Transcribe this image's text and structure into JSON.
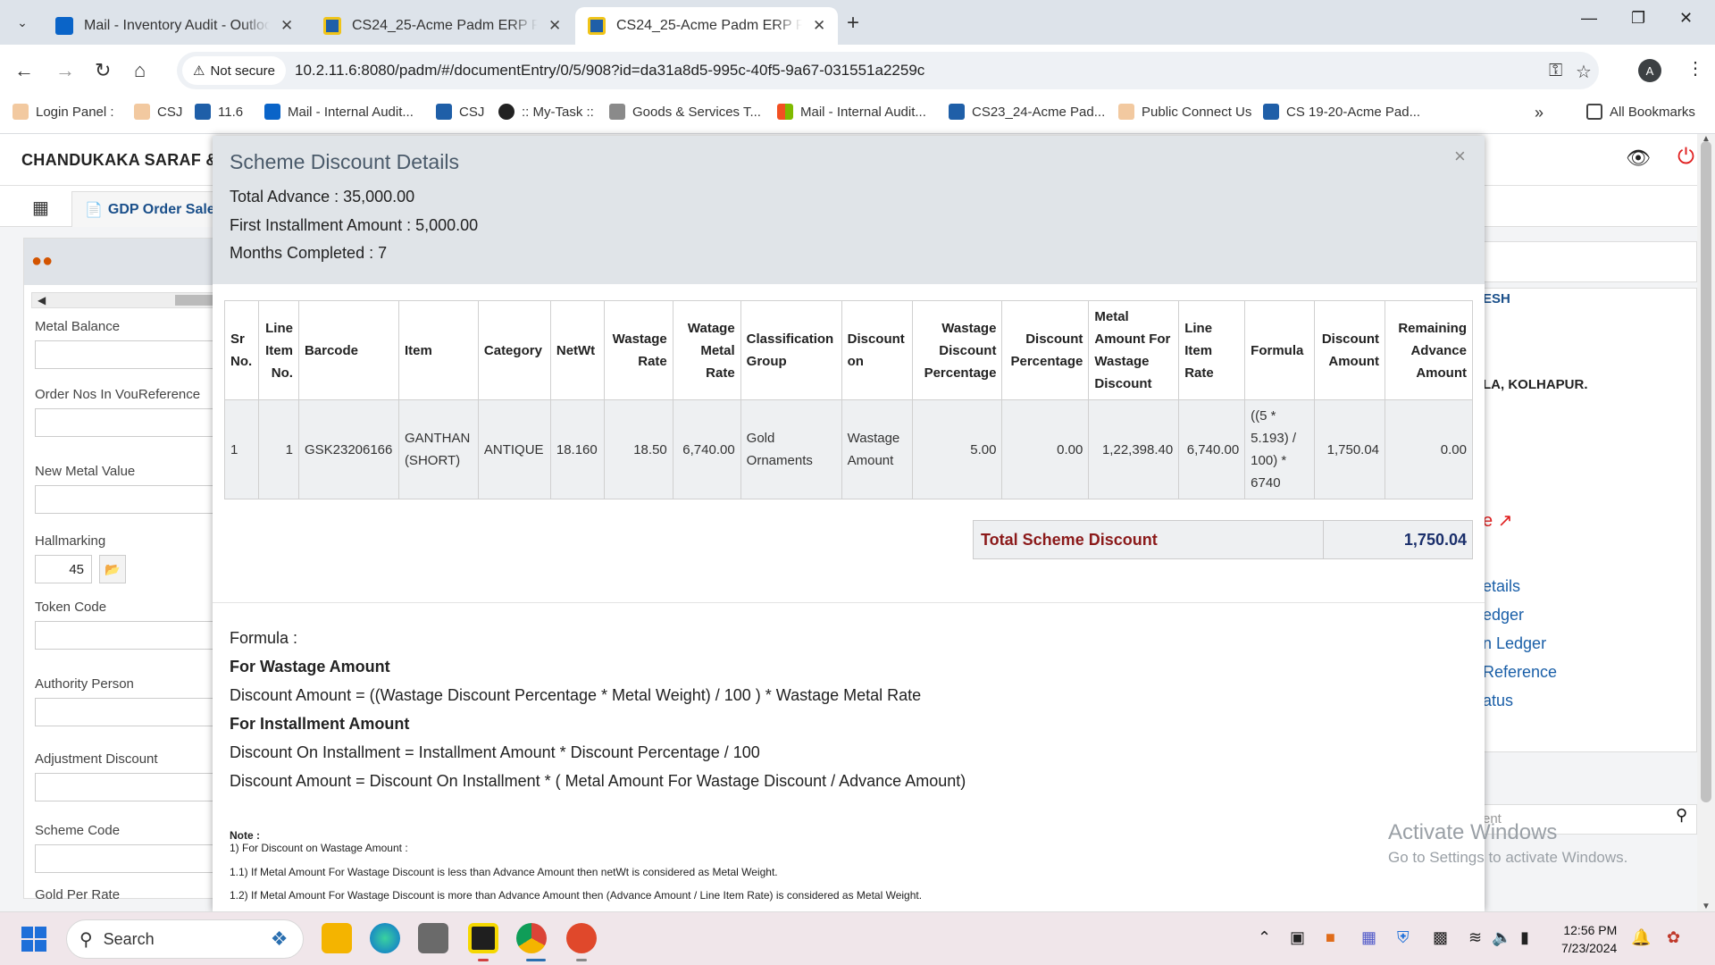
{
  "browser": {
    "tabs": [
      {
        "title": "Mail - Inventory Audit - Outlook",
        "active": false
      },
      {
        "title": "CS24_25-Acme Padm ERP Platform",
        "active": false
      },
      {
        "title": "CS24_25-Acme Padm ERP Platform",
        "active": true
      }
    ],
    "security_label": "Not secure",
    "url": "10.2.11.6:8080/padm/#/documentEntry/0/5/908?id=da31a8d5-995c-40f5-9a67-031551a2259c",
    "profile_initial": "A",
    "bookmarks": [
      "Login Panel :",
      "CSJ",
      "11.6",
      "Mail - Internal Audit...",
      "CSJ",
      ":: My-Task ::",
      "Goods & Services T...",
      "Mail - Internal Audit...",
      "CS23_24-Acme Pad...",
      "Public Connect Us",
      "CS 19-20-Acme Pad..."
    ],
    "all_bookmarks": "All Bookmarks"
  },
  "app": {
    "company": "CHANDUKAKA SARAF &",
    "doc_tab": "GDP Order Sales E",
    "fields": {
      "metal_balance": "Metal Balance",
      "order_nos": "Order Nos In VouReference",
      "new_metal_value": "New Metal Value",
      "hallmarking": "Hallmarking",
      "hallmarking_value": "45",
      "token_code": "Token Code",
      "authority_person": "Authority Person",
      "adjustment_discount": "Adjustment Discount",
      "scheme_code": "Scheme Code",
      "gold_per_rate": "Gold Per Rate"
    },
    "right_panel": {
      "header": "ESH",
      "address": "LA, KOLHAPUR.",
      "link_e": "e",
      "links": [
        "etails",
        "edger",
        "n Ledger",
        "Reference",
        "atus"
      ],
      "search_placeholder": "ent"
    }
  },
  "modal": {
    "title": "Scheme Discount Details",
    "total_advance": "Total Advance : 35,000.00",
    "first_installment": "First Installment Amount : 5,000.00",
    "months_completed": "Months Completed : 7",
    "columns": [
      "Sr No.",
      "Line Item No.",
      "Barcode",
      "Item",
      "Category",
      "NetWt",
      "Wastage Rate",
      "Watage Metal Rate",
      "Classification Group",
      "Discount on",
      "Wastage Discount Percentage",
      "Discount Percentage",
      "Metal Amount For Wastage Discount",
      "Line Item Rate",
      "Formula",
      "Discount Amount",
      "Remaining Advance Amount"
    ],
    "rows": [
      [
        "1",
        "1",
        "GSK23206166",
        "GANTHAN (SHORT)",
        "ANTIQUE",
        "18.160",
        "18.50",
        "6,740.00",
        "Gold Ornaments",
        "Wastage Amount",
        "5.00",
        "0.00",
        "1,22,398.40",
        "6,740.00",
        "((5 * 5.193) / 100) * 6740",
        "1,750.04",
        "0.00"
      ]
    ],
    "total_label": "Total Scheme Discount",
    "total_value": "1,750.04",
    "formula_heading": "Formula :",
    "wastage_heading": "For Wastage Amount",
    "wastage_formula": "Discount Amount = ((Wastage Discount Percentage * Metal Weight) / 100 ) * Wastage Metal Rate",
    "installment_heading": "For Installment Amount",
    "installment_formula1": "Discount On Installment = Installment Amount * Discount Percentage / 100",
    "installment_formula2": "Discount Amount = Discount On Installment * ( Metal Amount For Wastage Discount / Advance Amount)",
    "note_heading": "Note :",
    "note1": "1) For Discount on Wastage Amount :",
    "note1_1": "1.1) If Metal Amount For Wastage Discount is less than Advance Amount then netWt is considered as Metal Weight.",
    "note1_2": "1.2) If Metal Amount For Wastage Discount is more than Advance Amount then (Advance Amount / Line Item Rate) is considered as Metal Weight."
  },
  "watermark": {
    "line1": "Activate Windows",
    "line2": "Go to Settings to activate Windows."
  },
  "taskbar": {
    "search": "Search",
    "time": "12:56 PM",
    "date": "7/23/2024"
  }
}
